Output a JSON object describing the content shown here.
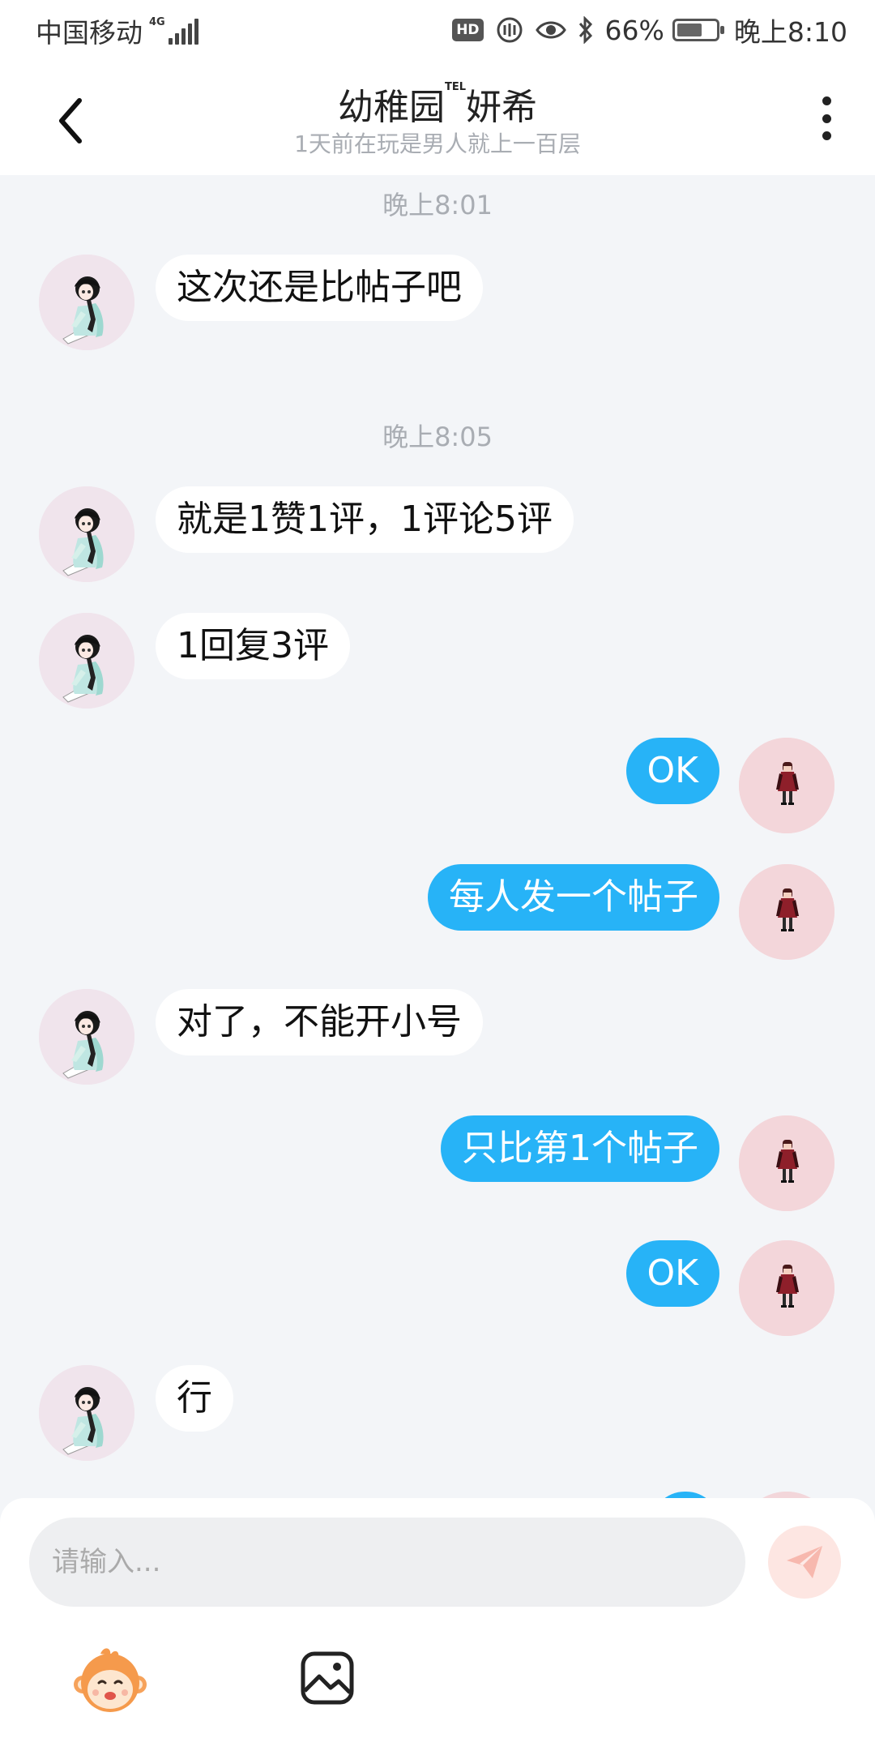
{
  "status_bar": {
    "carrier": "中国移动",
    "network": "4G",
    "hd": "HD",
    "battery": "66%",
    "battery_level": 0.66,
    "time": "晚上8:10"
  },
  "header": {
    "title_prefix": "幼稚园",
    "title_badge": "TEL",
    "title_suffix": "妍希",
    "subtitle": "1天前在玩是男人就上一百层"
  },
  "messages": [
    {
      "type": "timestamp",
      "text": "晚上8:01"
    },
    {
      "type": "in",
      "text": "这次还是比帖子吧"
    },
    {
      "type": "timestamp",
      "text": "晚上8:05"
    },
    {
      "type": "in",
      "text": "就是1赞1评，1评论5评"
    },
    {
      "type": "in",
      "text": "1回复3评"
    },
    {
      "type": "out",
      "text": "OK"
    },
    {
      "type": "out",
      "text": "每人发一个帖子"
    },
    {
      "type": "in",
      "text": "对了，不能开小号"
    },
    {
      "type": "out",
      "text": "只比第1个帖子"
    },
    {
      "type": "out",
      "text": "OK"
    },
    {
      "type": "in",
      "text": "行"
    }
  ],
  "input": {
    "placeholder": "请输入..."
  },
  "icons": {
    "back": "back-arrow-icon",
    "more": "more-vertical-icon",
    "send": "send-paper-plane-icon",
    "emoji": "monkey-emoji-icon",
    "image": "image-icon"
  },
  "colors": {
    "outgoing_bubble": "#27b3f7",
    "incoming_bubble": "#ffffff",
    "chat_background": "#f3f5f8",
    "send_button": "#fde6e2"
  }
}
